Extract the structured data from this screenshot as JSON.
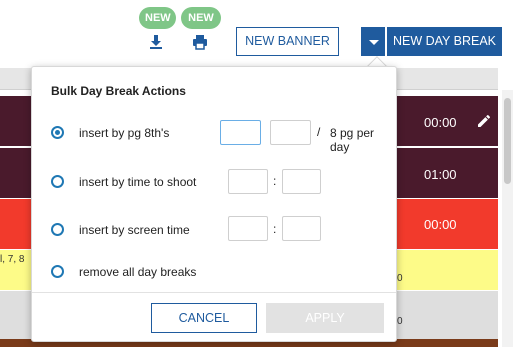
{
  "toolbar": {
    "badge_download": "NEW",
    "badge_print": "NEW",
    "download_icon": "download-icon",
    "print_icon": "print-icon",
    "new_banner_label": "NEW BANNER",
    "new_day_break_label": "NEW DAY BREAK",
    "dropdown_icon": "chevron-down-icon",
    "accent": "#1f5b9e",
    "badge_color": "#7fc687"
  },
  "schedule": {
    "rows": [
      {
        "time": "00:00",
        "color": "#4a1a2c",
        "has_edit": true
      },
      {
        "time": "01:00",
        "color": "#4a1a2c",
        "has_edit": false
      },
      {
        "time": "00:00",
        "color": "#f23a2c",
        "has_edit": false
      }
    ],
    "yellow_row_fragment": "l, 7, 8",
    "yellow_row_right": "0",
    "gray_row_right": "0"
  },
  "popover": {
    "title": "Bulk Day Break Actions",
    "options": [
      {
        "label": "insert by pg 8th's",
        "checked": true,
        "separator": "/",
        "suffix": "8 pg per day"
      },
      {
        "label": "insert by time to shoot",
        "checked": false,
        "separator": ":"
      },
      {
        "label": "insert by screen time",
        "checked": false,
        "separator": ":"
      },
      {
        "label": "remove all day breaks",
        "checked": false
      }
    ],
    "cancel_label": "CANCEL",
    "apply_label": "APPLY"
  }
}
